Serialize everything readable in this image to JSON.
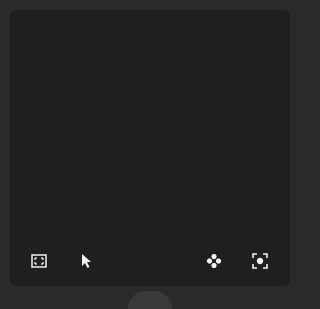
{
  "toolbar": {
    "tools": [
      {
        "id": "fit",
        "icon": "fit-to-screen-icon"
      },
      {
        "id": "select",
        "icon": "cursor-icon"
      },
      {
        "id": "move",
        "icon": "move-icon"
      },
      {
        "id": "focus",
        "icon": "focus-icon"
      }
    ]
  },
  "colors": {
    "background": "#2a2a2a",
    "canvas": "#1f1f1f",
    "icon": "#f2f2f2"
  }
}
